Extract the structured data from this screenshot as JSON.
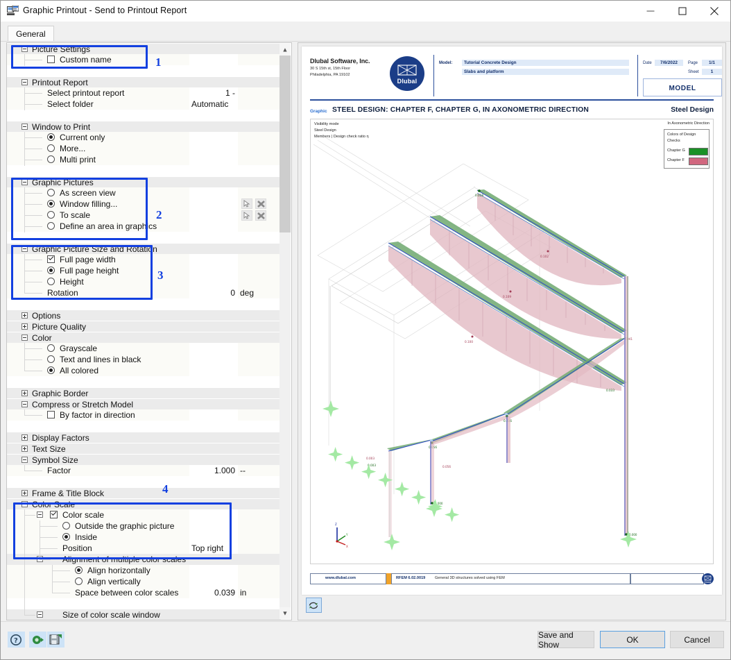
{
  "window": {
    "title": "Graphic Printout - Send to Printout Report",
    "minimize_label": "Minimize",
    "maximize_label": "Maximize",
    "close_label": "Close"
  },
  "tabs": [
    {
      "label": "General",
      "active": true
    }
  ],
  "callouts": [
    {
      "number": "1"
    },
    {
      "number": "2"
    },
    {
      "number": "3"
    },
    {
      "number": "4"
    }
  ],
  "tree": {
    "groups": [
      {
        "label": "Picture Settings"
      },
      {
        "label": "Printout Report"
      },
      {
        "label": "Window to Print"
      },
      {
        "label": "Graphic Pictures"
      },
      {
        "label": "Graphic Picture Size and Rotation"
      },
      {
        "label": "Options"
      },
      {
        "label": "Picture Quality"
      },
      {
        "label": "Color"
      },
      {
        "label": "Graphic Border"
      },
      {
        "label": "Compress or Stretch Model"
      },
      {
        "label": "Display Factors"
      },
      {
        "label": "Text Size"
      },
      {
        "label": "Symbol Size"
      },
      {
        "label": "Frame & Title Block"
      },
      {
        "label": "Color Scale"
      },
      {
        "label": "Color scale"
      },
      {
        "label": "Alignment of multiple color scales"
      },
      {
        "label": "Size of color scale window"
      }
    ],
    "items": {
      "custom_name": "Custom name",
      "select_printout_report": "Select printout report",
      "select_printout_report_value": "1 -",
      "select_folder": "Select folder",
      "select_folder_value": "Automatic",
      "current_only": "Current only",
      "more": "More...",
      "multi_print": "Multi print",
      "as_screen_view": "As screen view",
      "window_filling": "Window filling...",
      "to_scale": "To scale",
      "define_area": "Define an area in graphics",
      "full_page_width": "Full page width",
      "full_page_height": "Full page height",
      "height": "Height",
      "rotation": "Rotation",
      "rotation_value": "0",
      "rotation_unit": "deg",
      "grayscale": "Grayscale",
      "text_lines_black": "Text and lines in black",
      "all_colored": "All colored",
      "by_factor_direction": "By factor in direction",
      "factor": "Factor",
      "factor_value": "1.000",
      "factor_unit": "--",
      "outside_graphic": "Outside the graphic picture",
      "inside": "Inside",
      "position": "Position",
      "position_value": "Top right",
      "align_horizontally": "Align horizontally",
      "align_vertically": "Align vertically",
      "space_between": "Space between color scales",
      "space_between_value": "0.039",
      "space_between_unit": "in"
    }
  },
  "preview": {
    "header": {
      "company_name": "Dlubal Software, Inc.",
      "company_addr_1": "30 S 15th st, 15th Floor",
      "company_addr_2": "Philadelphia, PA 19102",
      "logo_text": "Dlubal",
      "model_label": "Model:",
      "model_value_1": "Tutorial Concrete Design",
      "model_value_2": "Slabs and platform",
      "date_label": "Date",
      "date_value": "7/6/2022",
      "page_label": "Page",
      "page_value": "1/1",
      "sheet_label": "Sheet",
      "sheet_value": "1",
      "doc_type": "MODEL"
    },
    "graphic": {
      "tag": "Graphic",
      "title": "STEEL DESIGN: CHAPTER F, CHAPTER G, IN AXONOMETRIC DIRECTION",
      "title_right": "Steel Design",
      "visibility_mode": "Visibility mode",
      "visibility_line_2": "Steel Design",
      "visibility_line_3": "Members | Design check ratio η",
      "direction_label": "In Axonometric Direction",
      "legend_title_1": "Colors of Design",
      "legend_title_2": "Checks",
      "legend_items": [
        {
          "label": "Chapter G",
          "color": "#1a9126"
        },
        {
          "label": "Chapter F",
          "color": "#d1677f"
        }
      ],
      "value_labels": [
        "0.018",
        "0.018",
        "0.102",
        "0.109",
        "0.100",
        "0.041",
        "0.033",
        "0.056",
        "0.056",
        "0.003",
        "0.000",
        "0.000",
        "0.000",
        "0.003"
      ]
    },
    "footer": {
      "website": "www.dlubal.com",
      "version": "RFEM 6.02.0019",
      "description": "General 3D structures solved using FEM"
    },
    "refresh_label": "Refresh"
  },
  "bottom": {
    "help_label": "Help",
    "info_label": "Info",
    "save_settings_label": "Save settings",
    "save_and_show": "Save and Show",
    "ok": "OK",
    "cancel": "Cancel"
  }
}
